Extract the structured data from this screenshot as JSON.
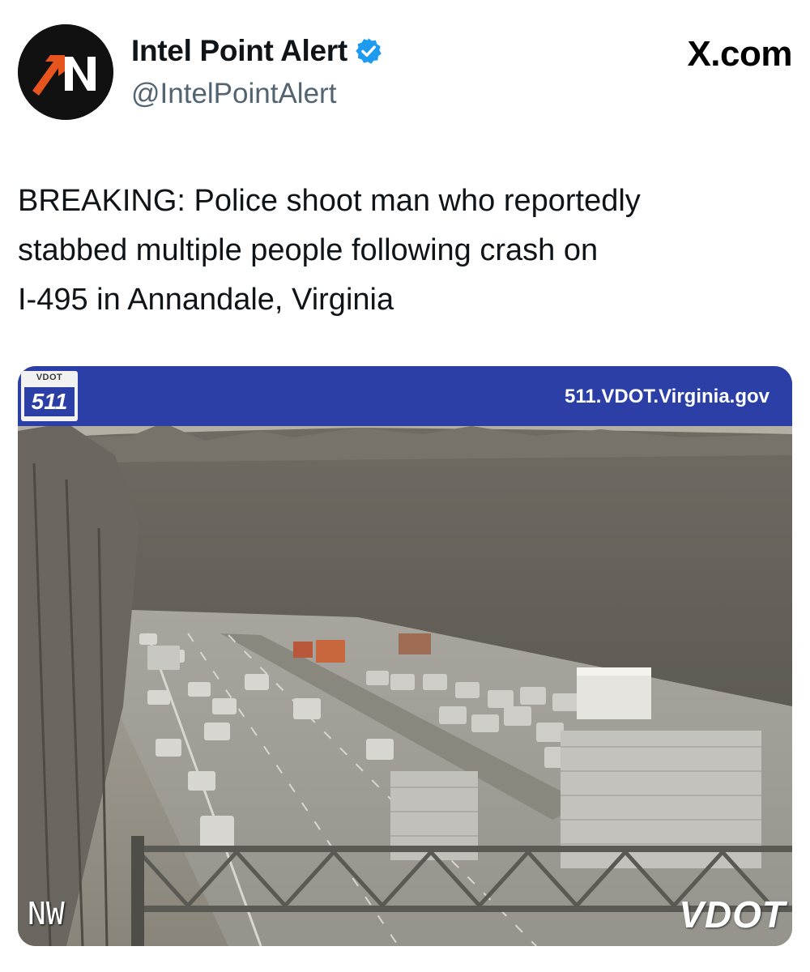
{
  "post": {
    "author": {
      "display_name": "Intel Point Alert",
      "handle": "@IntelPointAlert",
      "avatar_text": "IN",
      "verified_icon": "verified-badge-icon"
    },
    "source_site": "X.com",
    "text_lines": [
      "BREAKING: Police shoot man who reportedly",
      "stabbed multiple people following crash on",
      "I-495 in Annandale, Virginia"
    ],
    "media": {
      "banner_logo_small": "VDOT",
      "banner_logo_big": "511",
      "banner_url": "511.VDOT.Virginia.gov",
      "camera_direction": "NW",
      "camera_brand": "VDOT"
    }
  },
  "colors": {
    "accent_orange": "#e8541e",
    "verified_blue": "#1d9bf0",
    "vdot_blue": "#2b3fa6",
    "handle_gray": "#536471"
  }
}
